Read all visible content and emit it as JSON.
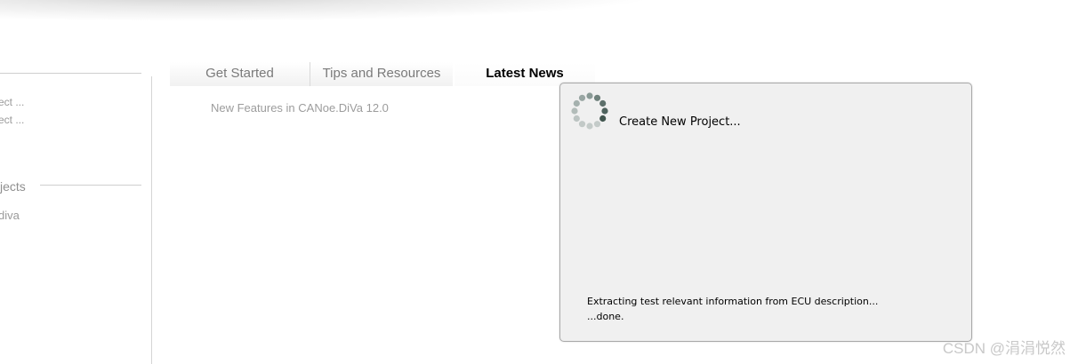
{
  "left_panel": {
    "recent_actions": [
      "ect ...",
      "ect ..."
    ],
    "projects_heading": "jects",
    "projects": [
      "diva"
    ]
  },
  "tabs": [
    {
      "label": "Get Started",
      "active": false
    },
    {
      "label": "Tips and Resources",
      "active": false
    },
    {
      "label": "Latest News",
      "active": true
    }
  ],
  "news": {
    "items": [
      "New Features in CANoe.DiVa 12.0"
    ]
  },
  "dialog": {
    "title": "Create New Project...",
    "icon": "spinner-icon",
    "messages": [
      "Extracting test relevant information from ECU description...",
      "...done."
    ]
  },
  "watermark": "CSDN @涓涓悦然",
  "colors": {
    "dialog_background": "#f0f0f0",
    "dialog_border": "#a8a8a8",
    "inactive_text": "#7a7a7a",
    "active_tab_text": "#000000"
  }
}
